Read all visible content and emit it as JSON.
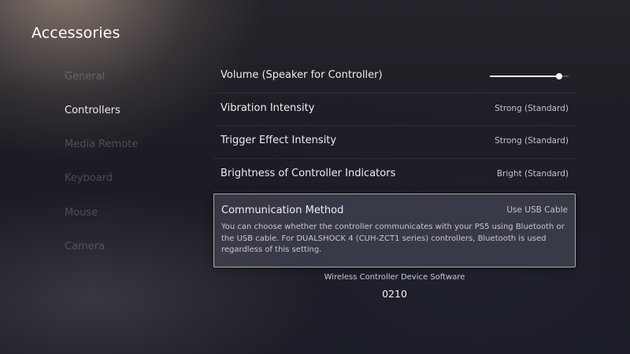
{
  "page": {
    "title": "Accessories"
  },
  "sidebar": {
    "items": [
      {
        "label": "General",
        "active": false
      },
      {
        "label": "Controllers",
        "active": true
      },
      {
        "label": "Media Remote",
        "active": false
      },
      {
        "label": "Keyboard",
        "active": false
      },
      {
        "label": "Mouse",
        "active": false
      },
      {
        "label": "Camera",
        "active": false
      }
    ]
  },
  "settings": {
    "volume": {
      "label": "Volume (Speaker for Controller)",
      "level": 0.88
    },
    "vibration": {
      "label": "Vibration Intensity",
      "value": "Strong (Standard)"
    },
    "trigger": {
      "label": "Trigger Effect Intensity",
      "value": "Strong (Standard)"
    },
    "brightness": {
      "label": "Brightness of Controller Indicators",
      "value": "Bright (Standard)"
    },
    "communication": {
      "label": "Communication Method",
      "value": "Use USB Cable",
      "description": "You can choose whether the controller communicates with your PS5 using Bluetooth or the USB cable. For DUALSHOCK 4 (CUH-ZCT1 series) controllers, Bluetooth is used regardless of this setting."
    }
  },
  "software": {
    "label": "Wireless Controller Device Software",
    "version": "0210"
  },
  "colors": {
    "text_primary": "#ECECF0",
    "nav_inactive": "#CDCDD7",
    "focus_border": "#E4DCD6"
  }
}
